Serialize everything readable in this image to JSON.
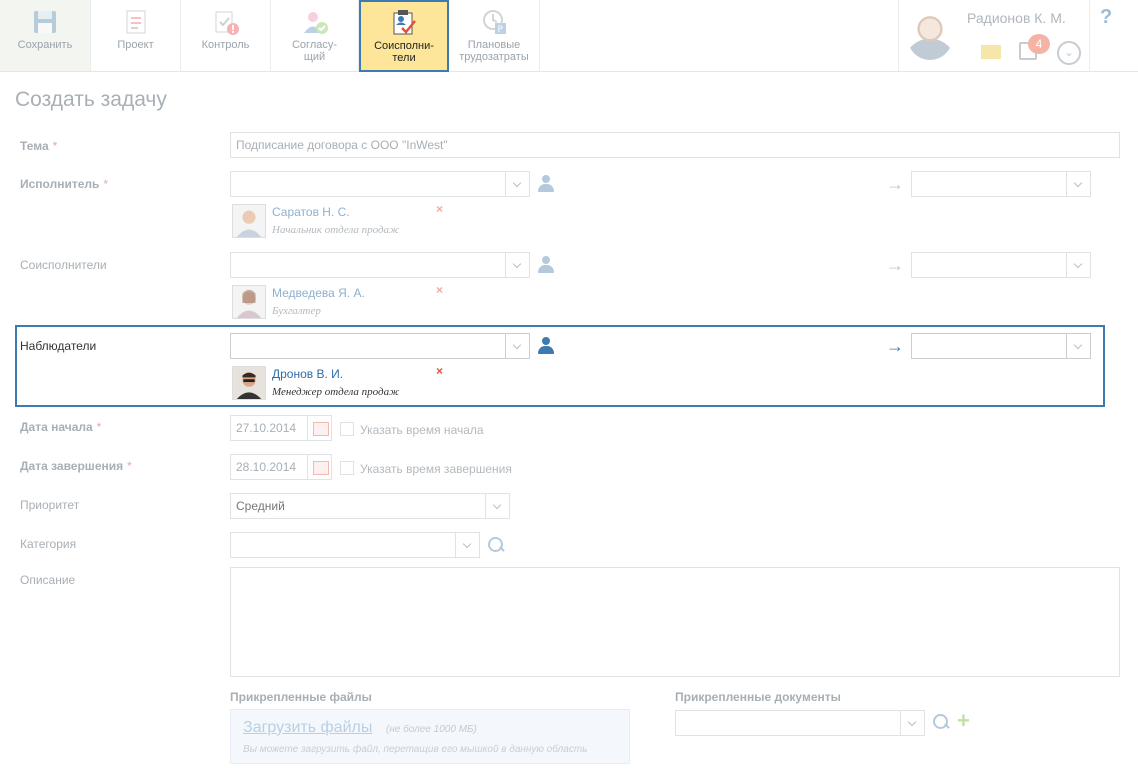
{
  "toolbar": {
    "save": "Сохранить",
    "project": "Проект",
    "control": "Контроль",
    "approvers": "Согласу-\nщий",
    "coexecutors": "Соисполни-\nтели",
    "planned": "Плановые\nтрудозатраты"
  },
  "user": {
    "name": "Радионов К. М.",
    "notifications": "4"
  },
  "help": "?",
  "page": {
    "title": "Создать задачу"
  },
  "form": {
    "subject": {
      "label": "Тема",
      "required": "*",
      "value": "Подписание договора с ООО \"InWest\""
    },
    "executor": {
      "label": "Исполнитель",
      "required": "*",
      "person": {
        "name": "Саратов Н. С.",
        "position": "Начальник отдела продаж"
      }
    },
    "coexecutors": {
      "label": "Соисполнители",
      "person": {
        "name": "Медведева Я. А.",
        "position": "Бухгалтер"
      }
    },
    "observers": {
      "label": "Наблюдатели",
      "person": {
        "name": "Дронов В. И.",
        "position": "Менеджер отдела продаж"
      }
    },
    "remove_glyph": "×",
    "start_date": {
      "label": "Дата начала",
      "required": "*",
      "value": "27.10.2014",
      "checkbox_label": "Указать время начала"
    },
    "end_date": {
      "label": "Дата завершения",
      "required": "*",
      "value": "28.10.2014",
      "checkbox_label": "Указать время завершения"
    },
    "priority": {
      "label": "Приоритет",
      "value": "Средний"
    },
    "category": {
      "label": "Категория"
    },
    "description": {
      "label": "Описание"
    },
    "attached_files": {
      "title": "Прикрепленные файлы",
      "upload_link": "Загрузить файлы",
      "limit": "(не более 1000 МБ)",
      "hint": "Вы можете загрузить файл, перетащив его мышкой в данную область"
    },
    "attached_docs": {
      "title": "Прикрепленные документы"
    }
  }
}
